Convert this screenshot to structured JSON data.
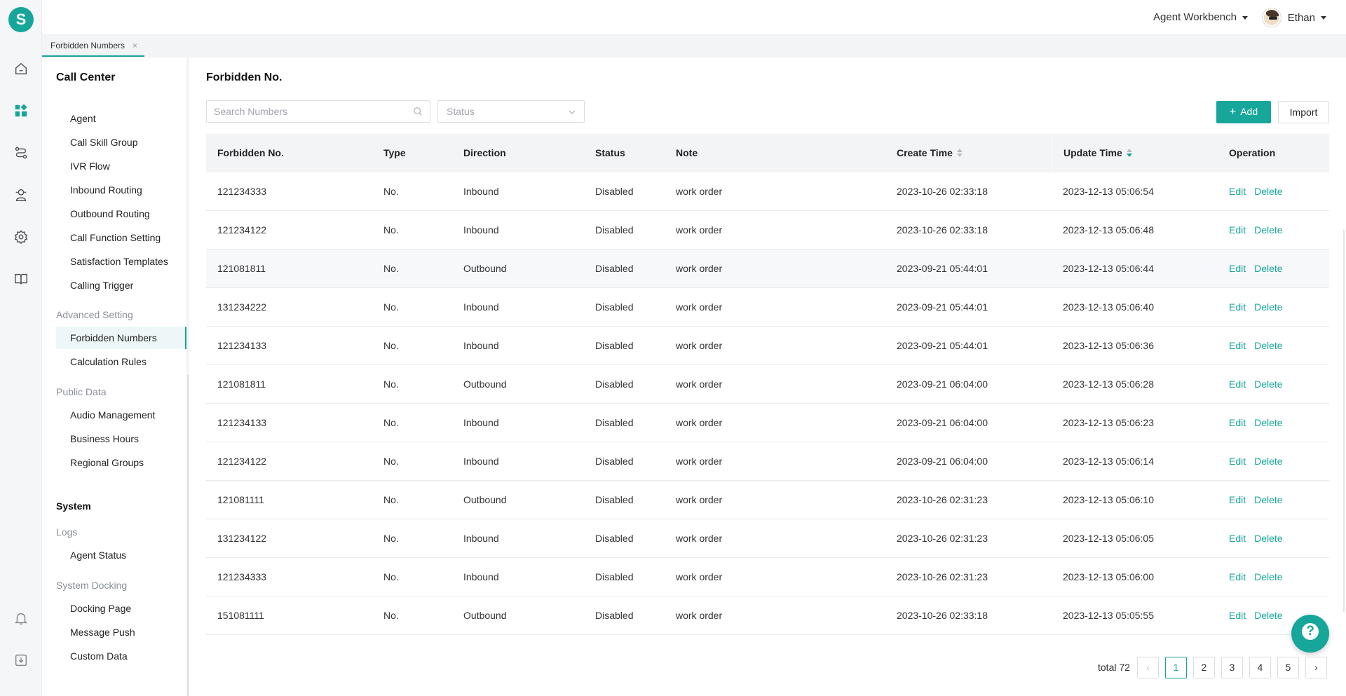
{
  "app": {
    "logo_letter": "S",
    "brand_color": "#17a69a"
  },
  "rail": {
    "icons": [
      "home-icon",
      "dashboard-icon",
      "routing-icon",
      "agent-icon",
      "settings-icon",
      "book-icon",
      "bell-icon",
      "download-icon"
    ]
  },
  "header": {
    "workbench_label": "Agent Workbench",
    "user_name": "Ethan"
  },
  "tabs": [
    {
      "label": "Forbidden Numbers",
      "close": "×"
    }
  ],
  "menu": {
    "call_center_title": "Call Center",
    "call_center_items": [
      "Agent",
      "Call Skill Group",
      "IVR Flow",
      "Inbound Routing",
      "Outbound Routing",
      "Call Function Setting",
      "Satisfaction Templates",
      "Calling Trigger"
    ],
    "advanced_section": "Advanced Setting",
    "advanced_items": [
      "Forbidden Numbers",
      "Calculation Rules"
    ],
    "public_section": "Public Data",
    "public_items": [
      "Audio Management",
      "Business Hours",
      "Regional Groups"
    ],
    "system_title": "System",
    "logs_section": "Logs",
    "logs_items": [
      "Agent Status"
    ],
    "docking_section": "System Docking",
    "docking_items": [
      "Docking Page",
      "Message Push",
      "Custom Data"
    ]
  },
  "main": {
    "title": "Forbidden No.",
    "search_placeholder": "Search Numbers",
    "status_placeholder": "Status",
    "add_label": "Add",
    "import_label": "Import",
    "columns": [
      "Forbidden No.",
      "Type",
      "Direction",
      "Status",
      "Note",
      "Create Time",
      "Update Time",
      "Operation"
    ],
    "rows": [
      [
        "121234333",
        "No.",
        "Inbound",
        "Disabled",
        "work order",
        "2023-10-26 02:33:18",
        "2023-12-13 05:06:54"
      ],
      [
        "121234122",
        "No.",
        "Inbound",
        "Disabled",
        "work order",
        "2023-10-26 02:33:18",
        "2023-12-13 05:06:48"
      ],
      [
        "121081811",
        "No.",
        "Outbound",
        "Disabled",
        "work order",
        "2023-09-21 05:44:01",
        "2023-12-13 05:06:44"
      ],
      [
        "131234222",
        "No.",
        "Inbound",
        "Disabled",
        "work order",
        "2023-09-21 05:44:01",
        "2023-12-13 05:06:40"
      ],
      [
        "121234133",
        "No.",
        "Inbound",
        "Disabled",
        "work order",
        "2023-09-21 05:44:01",
        "2023-12-13 05:06:36"
      ],
      [
        "121081811",
        "No.",
        "Outbound",
        "Disabled",
        "work order",
        "2023-09-21 06:04:00",
        "2023-12-13 05:06:28"
      ],
      [
        "121234133",
        "No.",
        "Inbound",
        "Disabled",
        "work order",
        "2023-09-21 06:04:00",
        "2023-12-13 05:06:23"
      ],
      [
        "121234122",
        "No.",
        "Inbound",
        "Disabled",
        "work order",
        "2023-09-21 06:04:00",
        "2023-12-13 05:06:14"
      ],
      [
        "121081111",
        "No.",
        "Outbound",
        "Disabled",
        "work order",
        "2023-10-26 02:31:23",
        "2023-12-13 05:06:10"
      ],
      [
        "131234122",
        "No.",
        "Inbound",
        "Disabled",
        "work order",
        "2023-10-26 02:31:23",
        "2023-12-13 05:06:05"
      ],
      [
        "121234333",
        "No.",
        "Inbound",
        "Disabled",
        "work order",
        "2023-10-26 02:31:23",
        "2023-12-13 05:06:00"
      ],
      [
        "151081111",
        "No.",
        "Outbound",
        "Disabled",
        "work order",
        "2023-10-26 02:33:18",
        "2023-12-13 05:05:55"
      ]
    ],
    "op_edit": "Edit",
    "op_delete": "Delete",
    "pagination": {
      "total_label": "total 72",
      "pages": [
        "1",
        "2",
        "3",
        "4",
        "5"
      ],
      "current": "1",
      "prev": "‹",
      "next": "›"
    }
  }
}
